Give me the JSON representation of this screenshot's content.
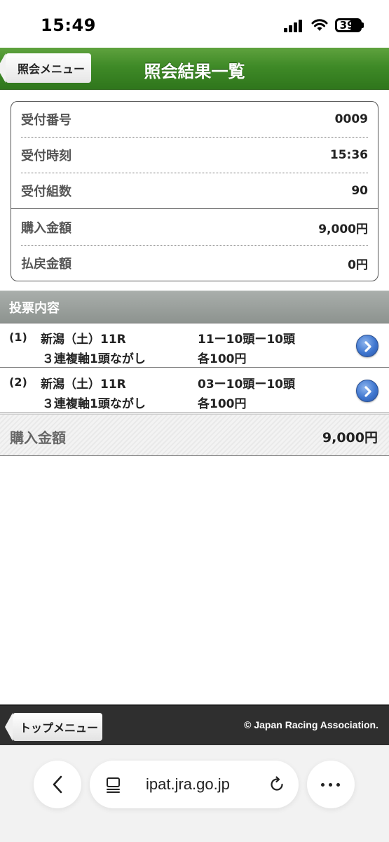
{
  "status_bar": {
    "time": "15:49",
    "battery": "39"
  },
  "header": {
    "back_label": "照会メニュー",
    "title": "照会結果一覧",
    "accent_color": "#3f8a27"
  },
  "summary": {
    "rows": [
      {
        "label": "受付番号",
        "value": "0009"
      },
      {
        "label": "受付時刻",
        "value": "15:36"
      },
      {
        "label": "受付組数",
        "value": "90"
      },
      {
        "label": "購入金額",
        "value": "9,000円"
      },
      {
        "label": "払戻金額",
        "value": "0円"
      }
    ]
  },
  "bets_section": {
    "title": "投票内容"
  },
  "bets": [
    {
      "num": "(1)",
      "race": "新潟（土）11R",
      "type": "３連複軸1頭ながし",
      "combo": "11ー10頭ー10頭",
      "amount": "各100円"
    },
    {
      "num": "(2)",
      "race": "新潟（土）11R",
      "type": "３連複軸1頭ながし",
      "combo": "03ー10頭ー10頭",
      "amount": "各100円"
    }
  ],
  "total": {
    "label": "購入金額",
    "value": "9,000円"
  },
  "footer": {
    "top_menu_label": "トップメニュー",
    "copyright": "© Japan Racing Association."
  },
  "browser": {
    "url": "ipat.jra.go.jp"
  }
}
